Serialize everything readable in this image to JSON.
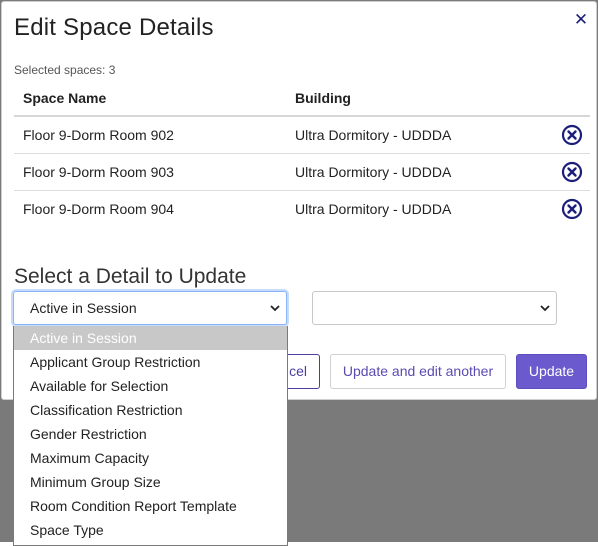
{
  "modal": {
    "title": "Edit Space Details",
    "close_icon": "close-x-icon",
    "selected_count_label": "Selected spaces: 3"
  },
  "table": {
    "headers": [
      "Space Name",
      "Building"
    ],
    "rows": [
      {
        "space_name": "Floor 9-Dorm Room 902",
        "building": "Ultra Dormitory - UDDDA"
      },
      {
        "space_name": "Floor 9-Dorm Room 903",
        "building": "Ultra Dormitory - UDDDA"
      },
      {
        "space_name": "Floor 9-Dorm Room 904",
        "building": "Ultra Dormitory - UDDDA"
      }
    ],
    "row_action_icon": "remove-circle-x-icon"
  },
  "detail": {
    "section_title": "Select a Detail to Update",
    "primary_select_value": "Active in Session",
    "secondary_select_value": "",
    "options": [
      "Active in Session",
      "Applicant Group Restriction",
      "Available for Selection",
      "Classification Restriction",
      "Gender Restriction",
      "Maximum Capacity",
      "Minimum Group Size",
      "Room Condition Report Template",
      "Space Type"
    ]
  },
  "buttons": {
    "cancel_label_visible": "cel",
    "update_another_label": "Update and edit another",
    "update_label": "Update"
  },
  "colors": {
    "accent": "#6a5acd",
    "icon_navy": "#1c1f7a",
    "selected_option_bg": "#c8c8c8"
  }
}
